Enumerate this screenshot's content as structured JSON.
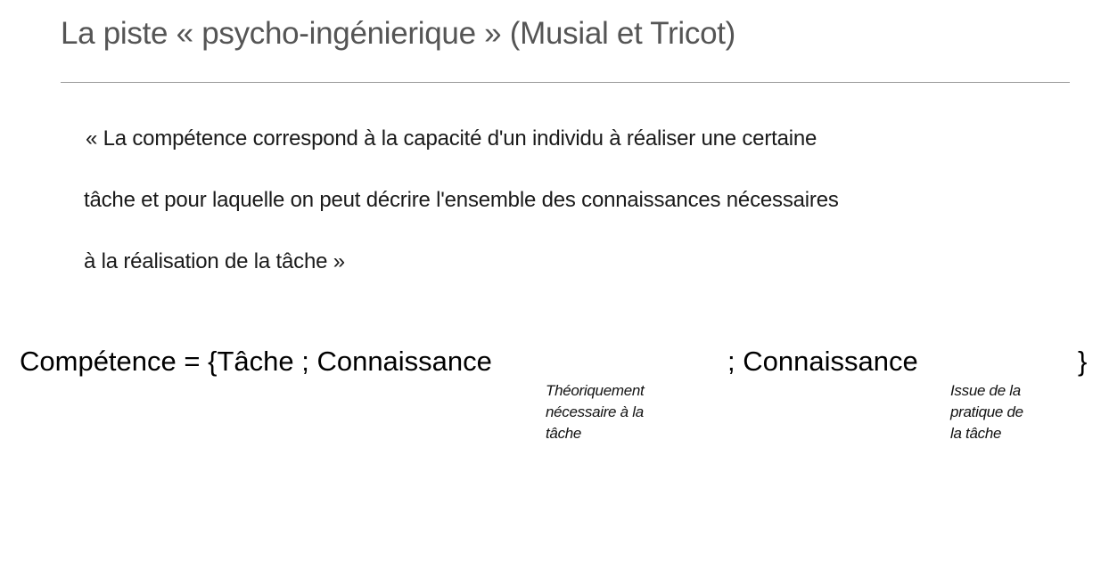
{
  "slide": {
    "title": "La piste « psycho-ingénierique » (Musial et Tricot)",
    "quote_lines": [
      "« La compétence correspond à la capacité d'un individu à réaliser une certaine",
      "tâche et pour laquelle on peut décrire l'ensemble des connaissances nécessaires",
      "à la réalisation de la tâche »"
    ],
    "formula": {
      "part1": "Compétence = {Tâche ; Connaissance",
      "part2": "; Connaissance",
      "closing_brace": "}"
    },
    "annotation_theoretical": [
      "Théoriquement",
      "nécessaire à la",
      "tâche"
    ],
    "annotation_practical": [
      "Issue de la",
      "pratique de",
      "la tâche"
    ]
  }
}
